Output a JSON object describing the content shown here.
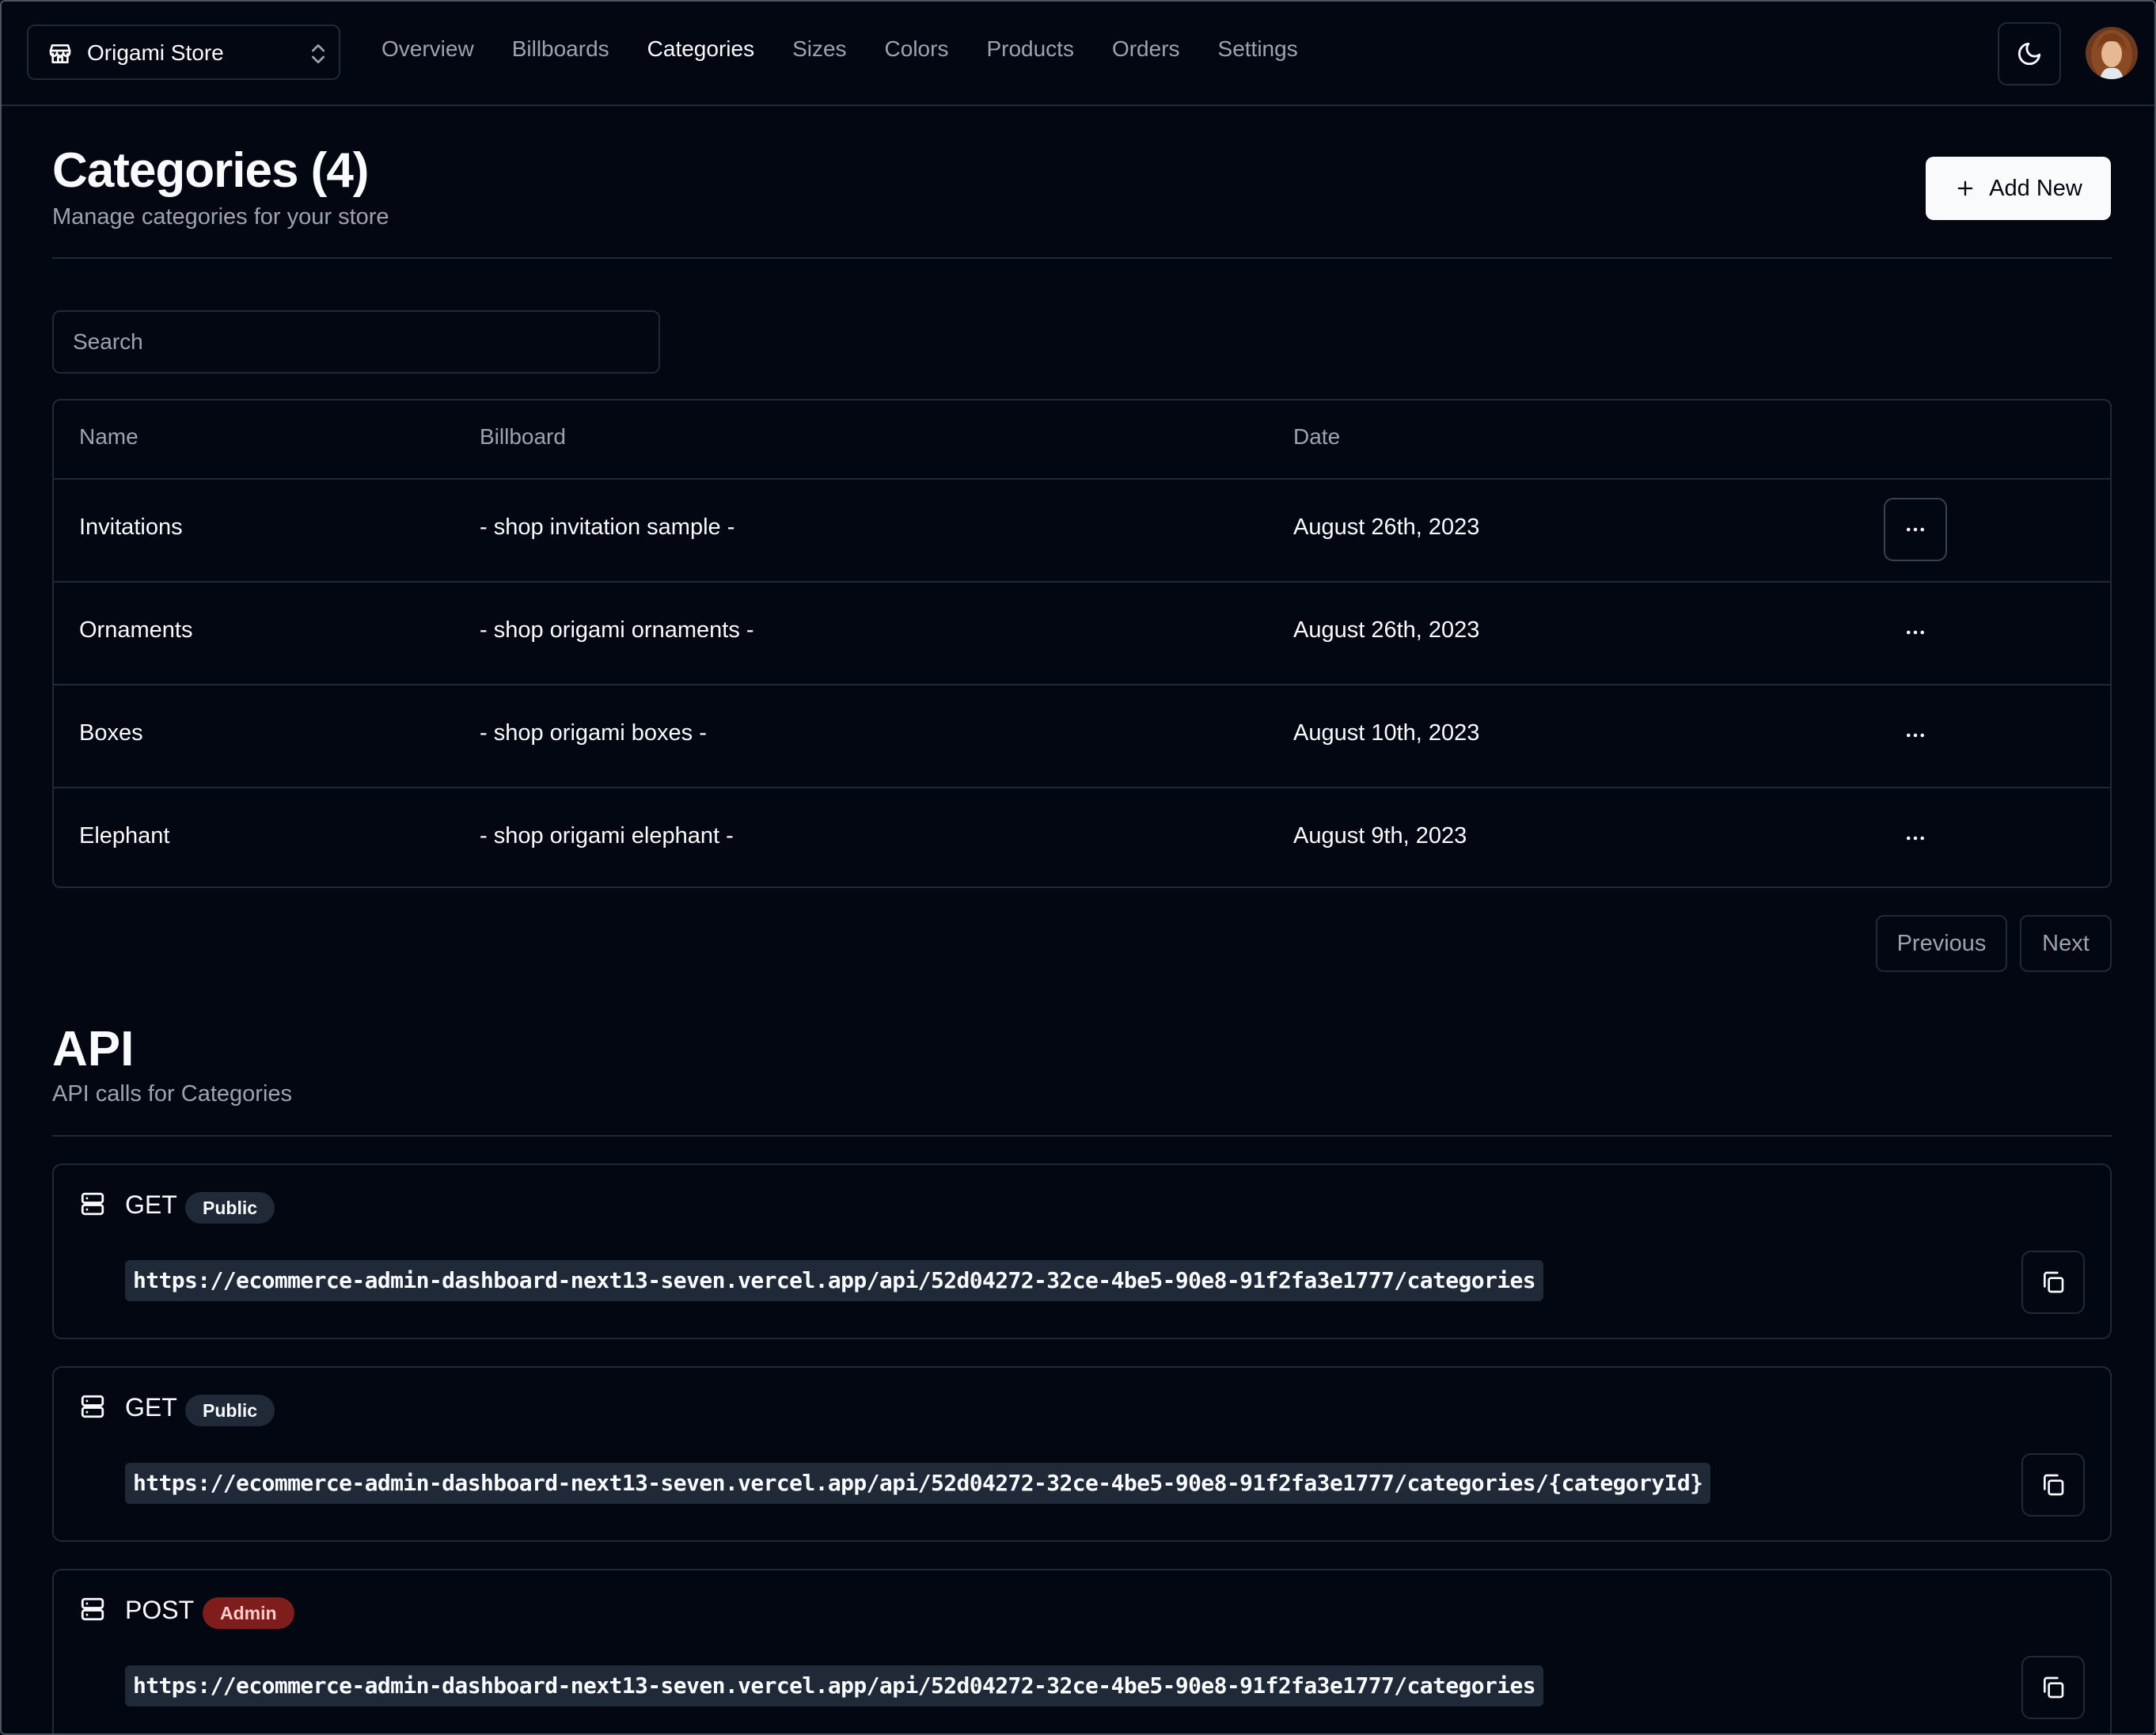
{
  "nav": {
    "store_name": "Origami Store",
    "links": [
      "Overview",
      "Billboards",
      "Categories",
      "Sizes",
      "Colors",
      "Products",
      "Orders",
      "Settings"
    ],
    "active": "Categories"
  },
  "header": {
    "title": "Categories (4)",
    "subtitle": "Manage categories for your store",
    "add_button": "Add New"
  },
  "search": {
    "placeholder": "Search"
  },
  "table": {
    "columns": [
      "Name",
      "Billboard",
      "Date"
    ],
    "rows": [
      {
        "name": "Invitations",
        "billboard": "- shop invitation sample -",
        "date": "August 26th, 2023"
      },
      {
        "name": "Ornaments",
        "billboard": "- shop origami ornaments -",
        "date": "August 26th, 2023"
      },
      {
        "name": "Boxes",
        "billboard": "- shop origami boxes -",
        "date": "August 10th, 2023"
      },
      {
        "name": "Elephant",
        "billboard": "- shop origami elephant -",
        "date": "August 9th, 2023"
      }
    ]
  },
  "pagination": {
    "previous": "Previous",
    "next": "Next"
  },
  "api": {
    "title": "API",
    "subtitle": "API calls for Categories",
    "calls": [
      {
        "method": "GET",
        "access": "Public",
        "url": "https://ecommerce-admin-dashboard-next13-seven.vercel.app/api/52d04272-32ce-4be5-90e8-91f2fa3e1777/categories"
      },
      {
        "method": "GET",
        "access": "Public",
        "url": "https://ecommerce-admin-dashboard-next13-seven.vercel.app/api/52d04272-32ce-4be5-90e8-91f2fa3e1777/categories/{categoryId}"
      },
      {
        "method": "POST",
        "access": "Admin",
        "url": "https://ecommerce-admin-dashboard-next13-seven.vercel.app/api/52d04272-32ce-4be5-90e8-91f2fa3e1777/categories"
      }
    ]
  },
  "colors": {
    "background": "#030712",
    "border": "#1f2937",
    "muted_text": "#9ca3af",
    "admin_badge": "#7f1d1d"
  },
  "icons": {
    "store": "store-icon",
    "switcher": "chevrons-up-down-icon",
    "theme": "moon-icon",
    "add": "plus-icon",
    "row_menu": "more-horizontal-icon",
    "api": "server-icon",
    "copy": "copy-icon"
  }
}
